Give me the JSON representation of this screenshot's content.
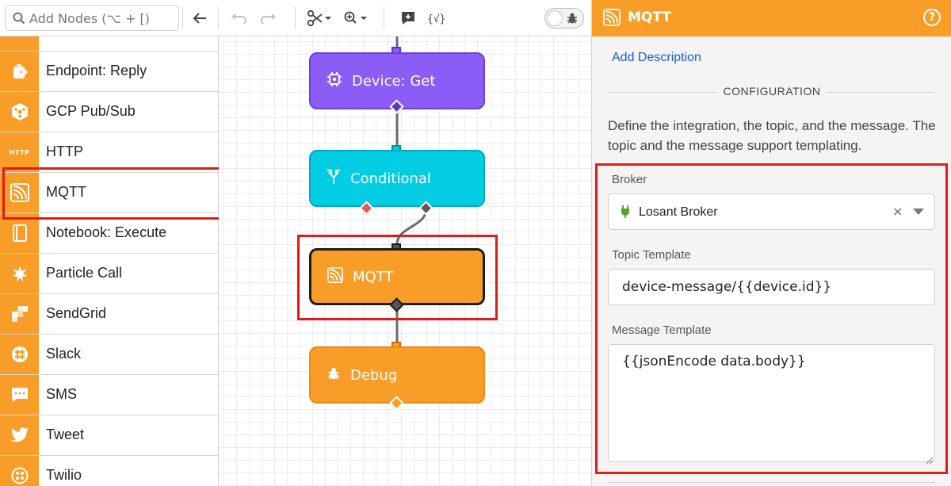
{
  "toolbar": {
    "search_placeholder": "Add Nodes (⌥ + [)"
  },
  "palette": {
    "items": [
      {
        "label": "Endpoint: Reply"
      },
      {
        "label": "GCP Pub/Sub"
      },
      {
        "label": "HTTP",
        "icon_text": "HTTP"
      },
      {
        "label": "MQTT"
      },
      {
        "label": "Notebook: Execute"
      },
      {
        "label": "Particle Call"
      },
      {
        "label": "SendGrid"
      },
      {
        "label": "Slack"
      },
      {
        "label": "SMS"
      },
      {
        "label": "Tweet"
      },
      {
        "label": "Twilio"
      }
    ]
  },
  "canvas": {
    "nodes": [
      {
        "label": "Device: Get",
        "color": "#8c5cf7"
      },
      {
        "label": "Conditional",
        "color": "#02cde3"
      },
      {
        "label": "MQTT",
        "color": "#f89d27"
      },
      {
        "label": "Debug",
        "color": "#f89d27"
      }
    ]
  },
  "panel": {
    "title": "MQTT",
    "add_description": "Add Description",
    "section_title": "CONFIGURATION",
    "description": "Define the integration, the topic, and the message. The topic and the message support templating.",
    "broker": {
      "label": "Broker",
      "value": "Losant Broker",
      "clear": "×"
    },
    "topic": {
      "label": "Topic Template",
      "value": "device-message/{{device.id}}"
    },
    "message": {
      "label": "Message Template",
      "value": "{{jsonEncode data.body}}"
    }
  },
  "colors": {
    "accent": "#f89d27",
    "highlight": "#e11b1b",
    "link": "#1f5ad6",
    "device_node": "#8c5cf7",
    "conditional_node": "#02cde3"
  }
}
